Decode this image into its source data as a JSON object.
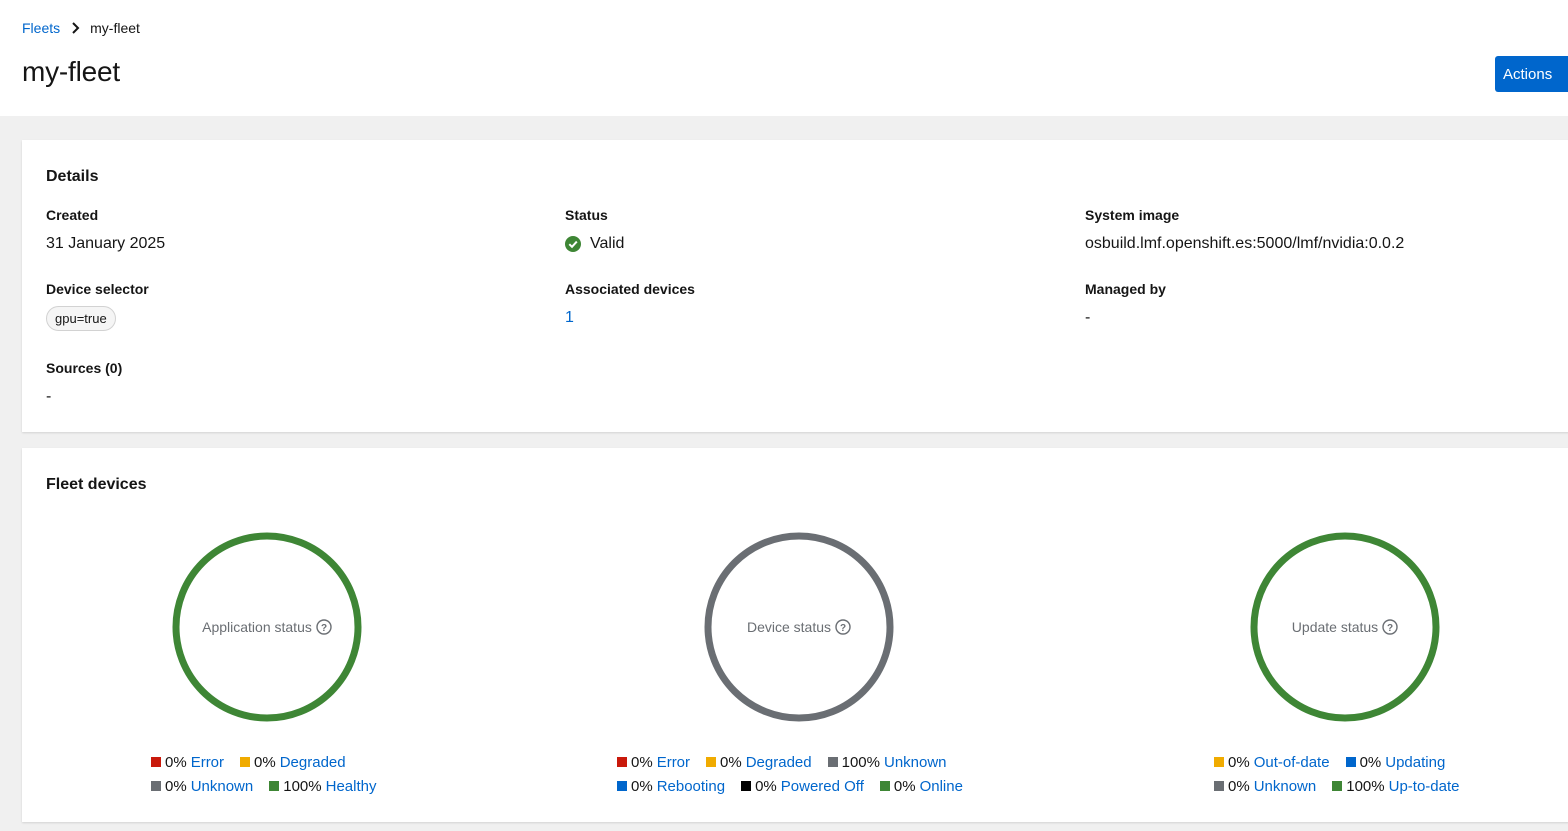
{
  "breadcrumb": {
    "parent": "Fleets",
    "current": "my-fleet"
  },
  "page": {
    "title": "my-fleet",
    "actions_label": "Actions"
  },
  "details": {
    "title": "Details",
    "created": {
      "label": "Created",
      "value": "31 January 2025"
    },
    "status": {
      "label": "Status",
      "value": "Valid",
      "color": "#3e8635"
    },
    "system_image": {
      "label": "System image",
      "value": "osbuild.lmf.openshift.es:5000/lmf/nvidia:0.0.2"
    },
    "device_selector": {
      "label": "Device selector",
      "chip": "gpu=true"
    },
    "associated_devices": {
      "label": "Associated devices",
      "value": "1"
    },
    "managed_by": {
      "label": "Managed by",
      "value": "-"
    },
    "sources": {
      "label": "Sources (0)",
      "value": "-"
    }
  },
  "fleet_devices": {
    "title": "Fleet devices",
    "charts": [
      {
        "title": "Application status",
        "ring_color": "#3e8635",
        "legend": [
          {
            "pct": "0%",
            "label": "Error",
            "color": "#c9190b"
          },
          {
            "pct": "0%",
            "label": "Degraded",
            "color": "#f0ab00"
          },
          {
            "pct": "0%",
            "label": "Unknown",
            "color": "#6a6e73"
          },
          {
            "pct": "100%",
            "label": "Healthy",
            "color": "#3e8635"
          }
        ]
      },
      {
        "title": "Device status",
        "ring_color": "#6a6e73",
        "legend": [
          {
            "pct": "0%",
            "label": "Error",
            "color": "#c9190b"
          },
          {
            "pct": "0%",
            "label": "Degraded",
            "color": "#f0ab00"
          },
          {
            "pct": "100%",
            "label": "Unknown",
            "color": "#6a6e73"
          },
          {
            "pct": "0%",
            "label": "Rebooting",
            "color": "#0066cc"
          },
          {
            "pct": "0%",
            "label": "Powered Off",
            "color": "#000000"
          },
          {
            "pct": "0%",
            "label": "Online",
            "color": "#3e8635"
          }
        ]
      },
      {
        "title": "Update status",
        "ring_color": "#3e8635",
        "legend": [
          {
            "pct": "0%",
            "label": "Out-of-date",
            "color": "#f0ab00"
          },
          {
            "pct": "0%",
            "label": "Updating",
            "color": "#0066cc"
          },
          {
            "pct": "0%",
            "label": "Unknown",
            "color": "#6a6e73"
          },
          {
            "pct": "100%",
            "label": "Up-to-date",
            "color": "#3e8635"
          }
        ]
      }
    ]
  }
}
